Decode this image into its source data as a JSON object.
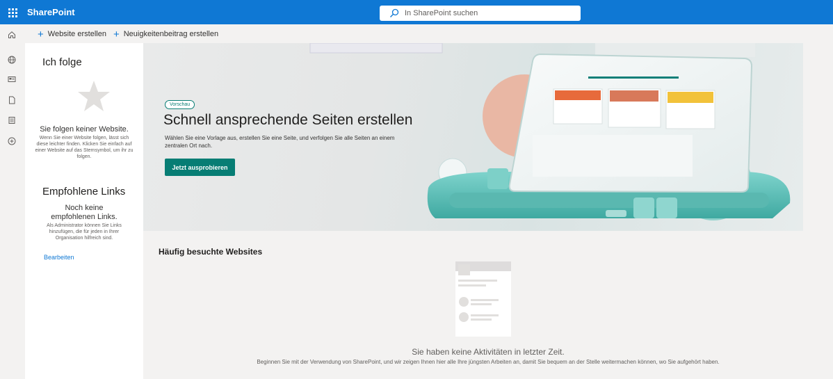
{
  "suite_bar": {
    "app_name": "SharePoint",
    "search_placeholder": "In SharePoint suchen",
    "accent_color": "#0f78d4"
  },
  "left_rail": {
    "items": [
      "home-icon",
      "globe-icon",
      "news-icon",
      "document-icon",
      "list-icon",
      "add-icon"
    ]
  },
  "command_bar": {
    "create_site": "Website erstellen",
    "create_news": "Neuigkeitenbeitrag erstellen"
  },
  "left_panel": {
    "following_title": "Ich folge",
    "no_sites_title": "Sie folgen keiner Website.",
    "no_sites_desc": "Wenn Sie einer Website folgen, lässt sich diese leichter finden. Klicken Sie einfach auf einer Website auf das Sternsymbol, um ihr zu folgen.",
    "recommended_title": "Empfohlene Links",
    "no_links_title": "Noch keine empfohlenen Links.",
    "no_links_desc": "Als Administrator können Sie Links hinzufügen, die für jeden in Ihrer Organisation hilfreich sind.",
    "edit_link": "Bearbeiten"
  },
  "hero": {
    "badge": "Vorschau",
    "title": "Schnell ansprechende Seiten erstellen",
    "description": "Wählen Sie eine Vorlage aus, erstellen Sie eine Seite, und verfolgen Sie alle Seiten an einem zentralen Ort nach.",
    "button": "Jetzt ausprobieren",
    "accent_color": "#077d74"
  },
  "frequent_sites": {
    "title": "Häufig besuchte Websites",
    "empty_title": "Sie haben keine Aktivitäten in letzter Zeit.",
    "empty_desc": "Beginnen Sie mit der Verwendung von SharePoint, und wir zeigen Ihnen hier alle Ihre jüngsten Arbeiten an, damit Sie bequem an der Stelle weitermachen können, wo Sie aufgehört haben."
  }
}
